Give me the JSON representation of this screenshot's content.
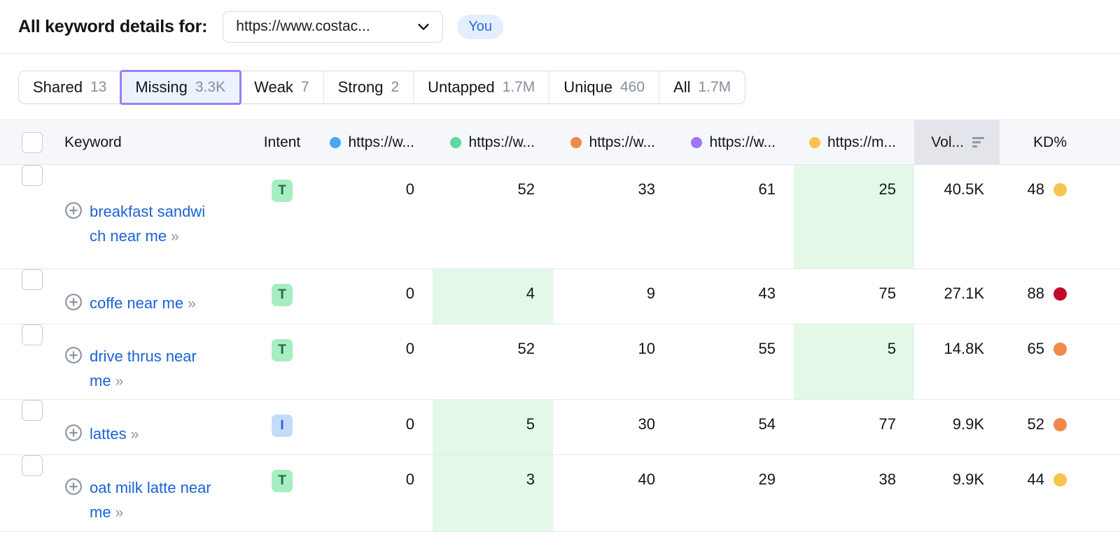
{
  "header": {
    "title": "All keyword details for:",
    "url_select": {
      "value": "https://www.costac...",
      "icon": "chevron-down-icon"
    },
    "you_badge": "You"
  },
  "tabs": [
    {
      "label": "Shared",
      "count": "13",
      "active": false
    },
    {
      "label": "Missing",
      "count": "3.3K",
      "active": true
    },
    {
      "label": "Weak",
      "count": "7",
      "active": false
    },
    {
      "label": "Strong",
      "count": "2",
      "active": false
    },
    {
      "label": "Untapped",
      "count": "1.7M",
      "active": false
    },
    {
      "label": "Unique",
      "count": "460",
      "active": false
    },
    {
      "label": "All",
      "count": "1.7M",
      "active": false
    }
  ],
  "table": {
    "columns": {
      "keyword": "Keyword",
      "intent": "Intent",
      "volume": "Vol...",
      "kd": "KD%"
    },
    "competitors": [
      {
        "label": "https://w...",
        "color": "#4aa6f5"
      },
      {
        "label": "https://w...",
        "color": "#5fd7a0"
      },
      {
        "label": "https://w...",
        "color": "#f08a4b"
      },
      {
        "label": "https://w...",
        "color": "#a075f5"
      },
      {
        "label": "https://m...",
        "color": "#f5c44b"
      }
    ],
    "sorted_column": "volume",
    "sort_icon": "sort-descending-icon",
    "highlight_color": "#e3f8e6",
    "rows": [
      {
        "keyword": "breakfast sandwich near me",
        "intent": "T",
        "ranks": [
          "0",
          "52",
          "33",
          "61",
          "25"
        ],
        "highlight_index": 4,
        "volume": "40.5K",
        "kd": "48",
        "kd_color": "#f5c44b"
      },
      {
        "keyword": "coffe near me",
        "intent": "T",
        "ranks": [
          "0",
          "4",
          "9",
          "43",
          "75"
        ],
        "highlight_index": 1,
        "volume": "27.1K",
        "kd": "88",
        "kd_color": "#c00b26"
      },
      {
        "keyword": "drive thrus near me",
        "intent": "T",
        "ranks": [
          "0",
          "52",
          "10",
          "55",
          "5"
        ],
        "highlight_index": 4,
        "volume": "14.8K",
        "kd": "65",
        "kd_color": "#f08a4b"
      },
      {
        "keyword": "lattes",
        "intent": "I",
        "ranks": [
          "0",
          "5",
          "30",
          "54",
          "77"
        ],
        "highlight_index": 1,
        "volume": "9.9K",
        "kd": "52",
        "kd_color": "#f08a4b"
      },
      {
        "keyword": "oat milk latte near me",
        "intent": "T",
        "ranks": [
          "0",
          "3",
          "40",
          "29",
          "38"
        ],
        "highlight_index": 1,
        "volume": "9.9K",
        "kd": "44",
        "kd_color": "#f5c44b"
      }
    ]
  }
}
